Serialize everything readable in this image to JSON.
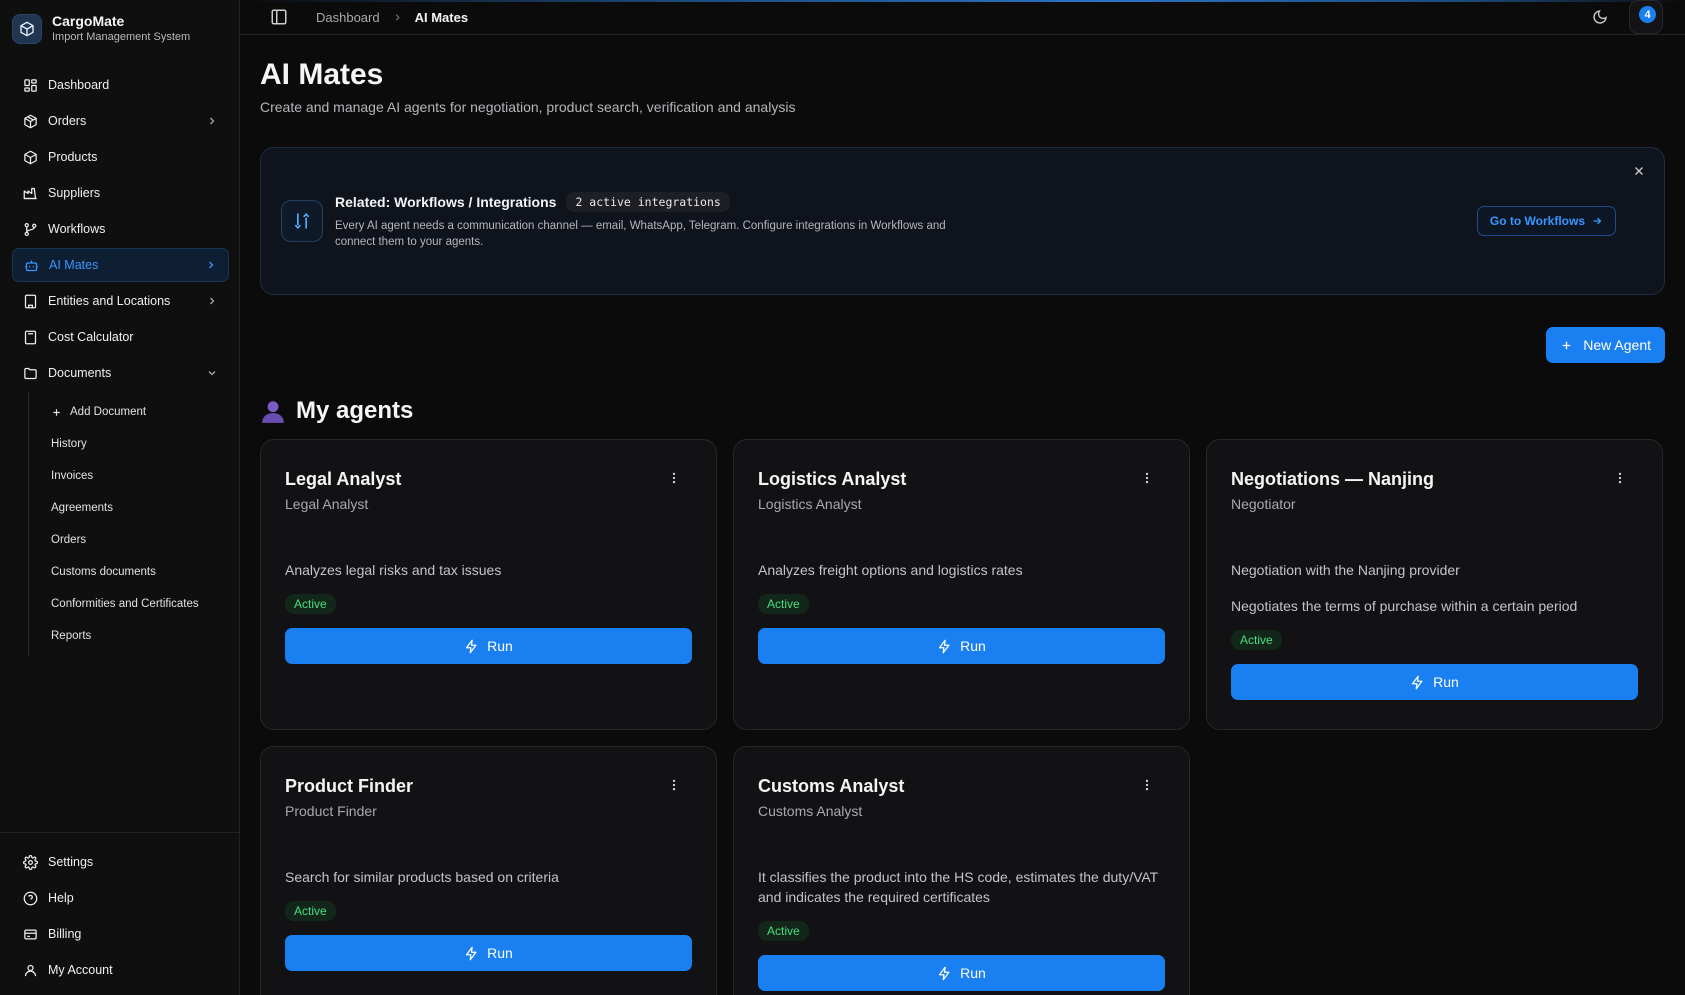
{
  "brand": {
    "title": "CargoMate",
    "subtitle": "Import Management System"
  },
  "sidebar": {
    "items": [
      {
        "label": "Dashboard",
        "icon": "dashboard-icon"
      },
      {
        "label": "Orders",
        "icon": "orders-icon"
      },
      {
        "label": "Products",
        "icon": "package-icon"
      },
      {
        "label": "Suppliers",
        "icon": "factory-icon"
      },
      {
        "label": "Workflows",
        "icon": "workflow-icon"
      },
      {
        "label": "AI Mates",
        "icon": "bot-icon"
      },
      {
        "label": "Entities and Locations",
        "icon": "building-icon"
      },
      {
        "label": "Cost Calculator",
        "icon": "calculator-icon"
      },
      {
        "label": "Documents",
        "icon": "folder-icon"
      }
    ],
    "documents_sub": [
      "Add Document",
      "History",
      "Invoices",
      "Agreements",
      "Orders",
      "Customs documents",
      "Conformities and Certificates",
      "Reports"
    ],
    "bottom": [
      {
        "label": "Settings",
        "icon": "gear-icon"
      },
      {
        "label": "Help",
        "icon": "help-icon"
      },
      {
        "label": "Billing",
        "icon": "billing-icon"
      },
      {
        "label": "My Account",
        "icon": "user-icon"
      }
    ]
  },
  "topbar": {
    "breadcrumb": [
      "Dashboard",
      "AI Mates"
    ],
    "notifications": "4"
  },
  "page": {
    "title": "AI Mates",
    "subtitle": "Create and manage AI agents for negotiation, product search, verification and analysis"
  },
  "banner": {
    "title": "Related: Workflows / Integrations",
    "chip": "2 active integrations",
    "description": "Every AI agent needs a communication channel — email, WhatsApp, Telegram. Configure integrations in Workflows and connect them to your agents.",
    "cta": "Go to Workflows"
  },
  "actions": {
    "new_agent": "New Agent"
  },
  "section": {
    "title": "My agents"
  },
  "agents": [
    {
      "name": "Legal Analyst",
      "role": "Legal Analyst",
      "desc": "Analyzes legal risks and tax issues",
      "desc2": "",
      "status": "Active",
      "run": "Run"
    },
    {
      "name": "Logistics Analyst",
      "role": "Logistics Analyst",
      "desc": "Analyzes freight options and logistics rates",
      "desc2": "",
      "status": "Active",
      "run": "Run"
    },
    {
      "name": "Negotiations — Nanjing",
      "role": "Negotiator",
      "desc": "Negotiation with the Nanjing provider",
      "desc2": "Negotiates the terms of purchase within a certain period",
      "status": "Active",
      "run": "Run"
    },
    {
      "name": "Product Finder",
      "role": "Product Finder",
      "desc": "Search for similar products based on criteria",
      "desc2": "",
      "status": "Active",
      "run": "Run"
    },
    {
      "name": "Customs Analyst",
      "role": "Customs Analyst",
      "desc": "It classifies the product into the HS code, estimates the duty/VAT and indicates the required certificates",
      "desc2": "",
      "status": "Active",
      "run": "Run"
    }
  ],
  "colors": {
    "accent": "#1a7ff0",
    "active_status": "#4ade80",
    "background": "#0b0b0c"
  }
}
